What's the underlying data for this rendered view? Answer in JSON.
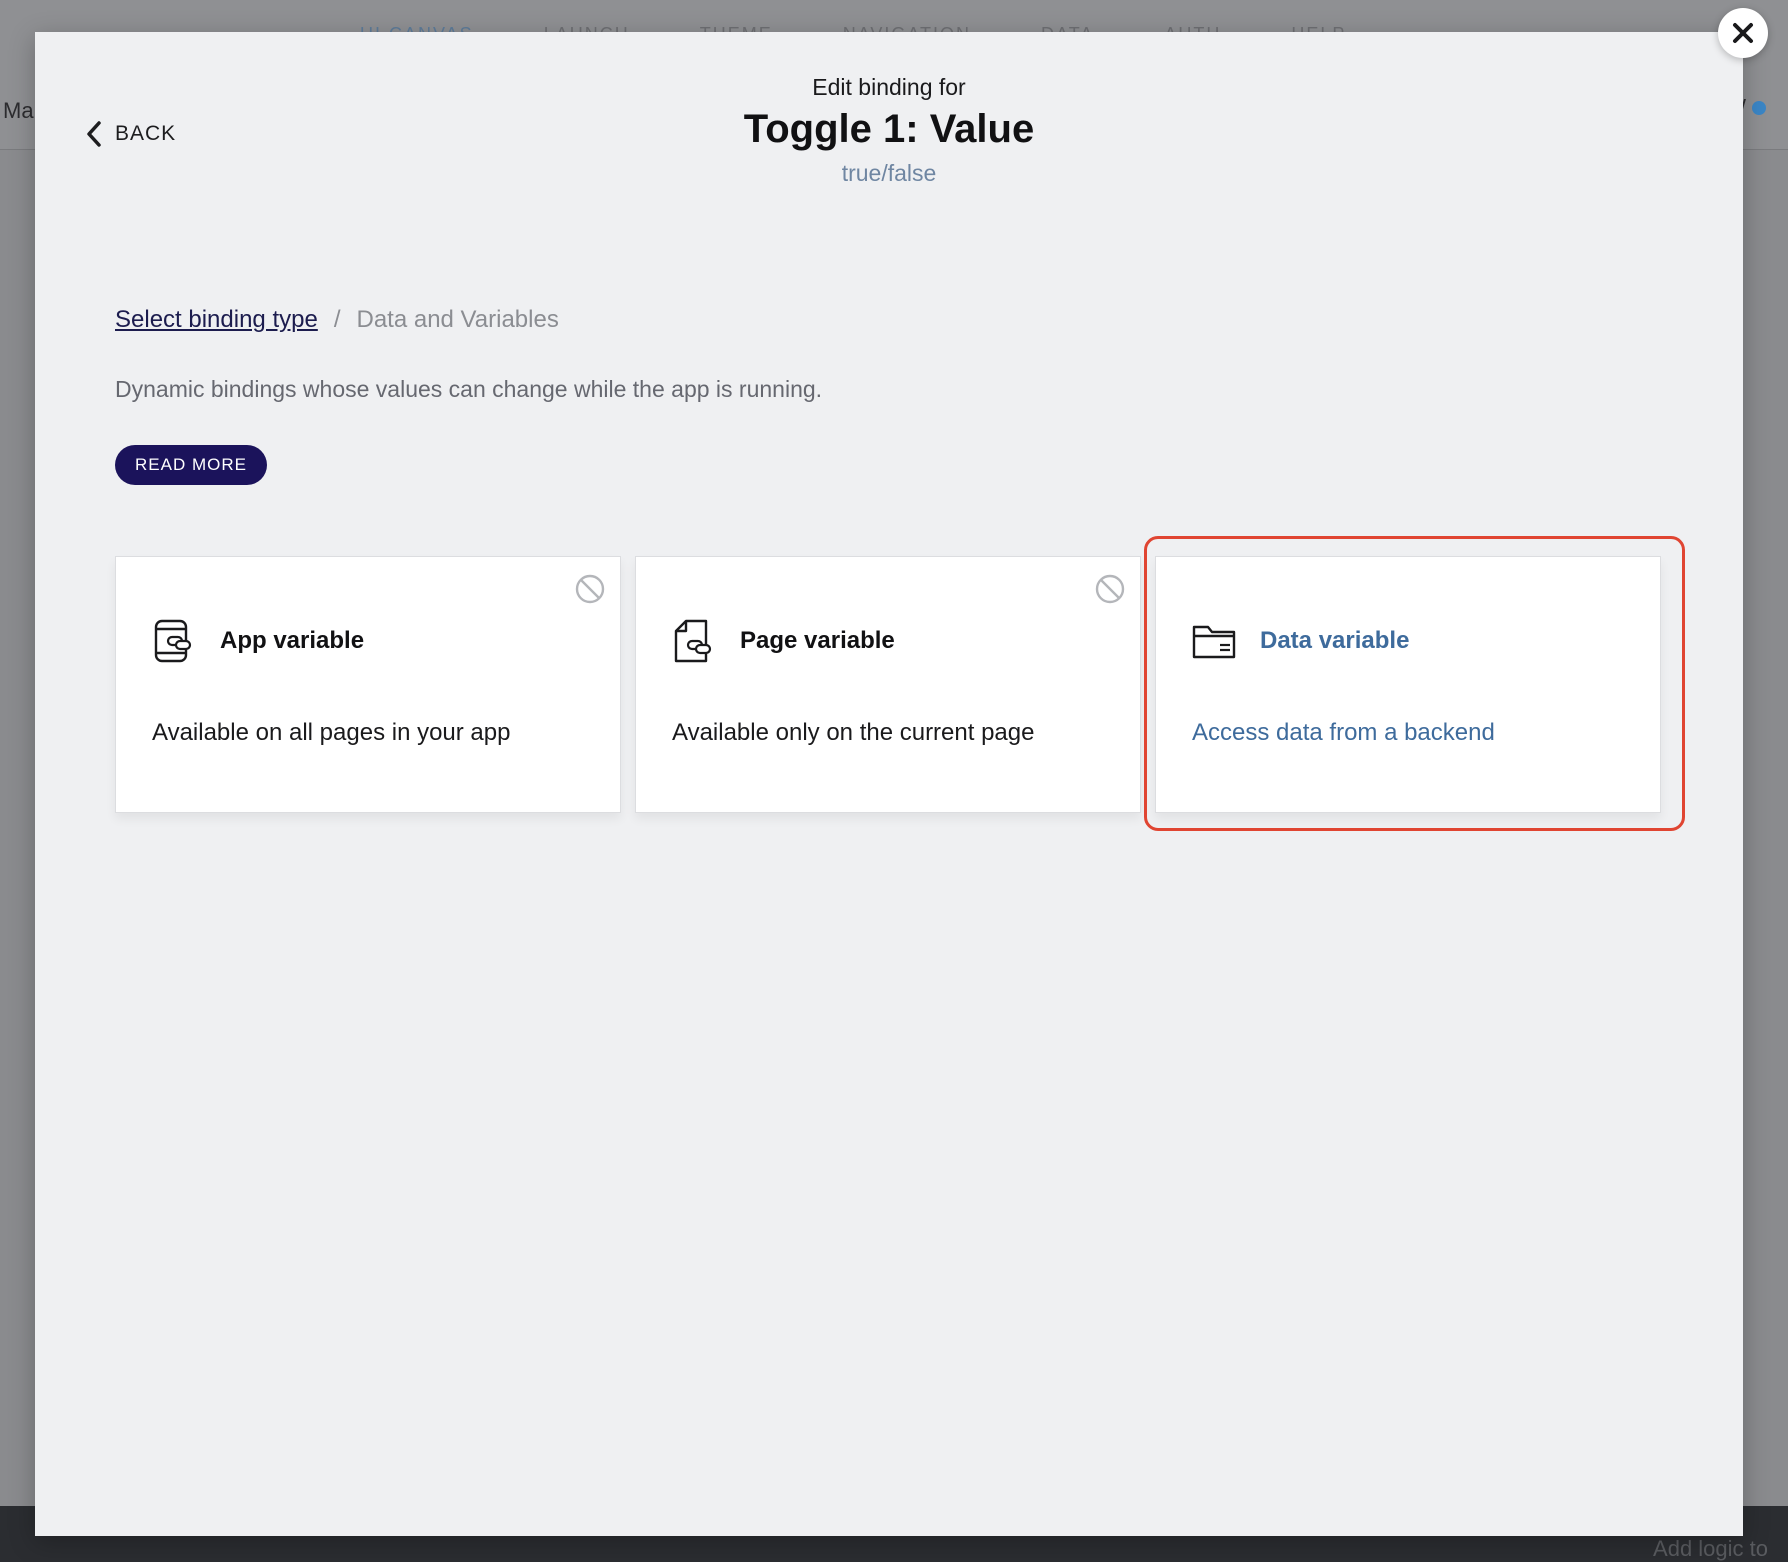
{
  "background": {
    "nav_items": [
      "UI CANVAS",
      "LAUNCH",
      "THEME",
      "NAVIGATION",
      "DATA",
      "AUTH",
      "HELP"
    ],
    "left_text": "Ma",
    "right_text": "EW",
    "bottom_text": "Add logic to"
  },
  "modal": {
    "back_label": "BACK",
    "subheading": "Edit binding for",
    "title": "Toggle 1: Value",
    "value_type": "true/false",
    "breadcrumb": {
      "link": "Select binding type",
      "separator": "/",
      "current": "Data and Variables"
    },
    "description": "Dynamic bindings whose values can change while the app is running.",
    "read_more_label": "READ MORE",
    "cards": [
      {
        "title": "App variable",
        "description": "Available on all pages in your app",
        "icon": "app-variable-icon",
        "disabled": true
      },
      {
        "title": "Page variable",
        "description": "Available only on the current page",
        "icon": "page-variable-icon",
        "disabled": true
      },
      {
        "title": "Data variable",
        "description": "Access data from a backend",
        "icon": "folder-icon",
        "disabled": false
      }
    ]
  },
  "colors": {
    "accent": "#1b135b",
    "highlight": "#e04532",
    "data_variable_text": "#3e6b9c"
  }
}
